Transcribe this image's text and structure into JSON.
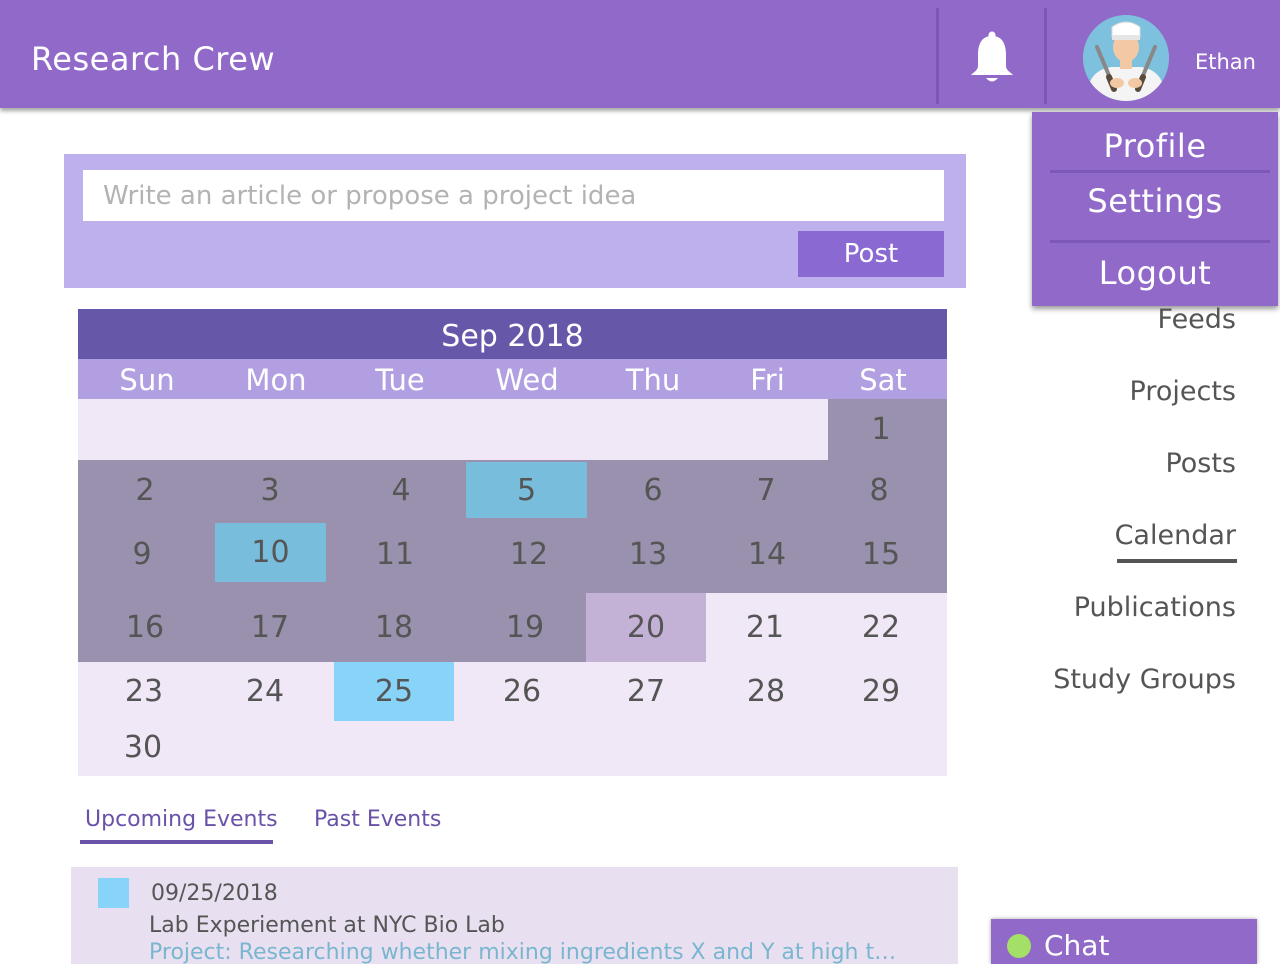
{
  "header": {
    "title": "Research Crew",
    "username": "Ethan",
    "bell_icon": "bell-icon",
    "avatar_icon": "chef-avatar"
  },
  "user_menu": {
    "items": [
      "Profile",
      "Settings",
      "Logout"
    ]
  },
  "composer": {
    "placeholder": "Write an article or propose a project idea",
    "post_label": "Post"
  },
  "calendar": {
    "month_label": "Sep 2018",
    "weekdays": [
      "Sun",
      "Mon",
      "Tue",
      "Wed",
      "Thu",
      "Fri",
      "Sat"
    ],
    "days": [
      "1",
      "2",
      "3",
      "4",
      "5",
      "6",
      "7",
      "8",
      "9",
      "10",
      "11",
      "12",
      "13",
      "14",
      "15",
      "16",
      "17",
      "18",
      "19",
      "20",
      "21",
      "22",
      "23",
      "24",
      "25",
      "26",
      "27",
      "28",
      "29",
      "30"
    ],
    "colors": {
      "past": "#9991ad",
      "event": "#78bddb",
      "today": "#c4b1d6",
      "upcoming_event": "#88d3f8",
      "future": "#f0e8f6"
    }
  },
  "events": {
    "tabs": [
      "Upcoming Events",
      "Past Events"
    ],
    "list": [
      {
        "date": "09/25/2018",
        "title": "Lab Experiement at NYC Bio Lab",
        "description": "Project: Researching whether mixing ingredients X and Y at high temp ..."
      }
    ]
  },
  "nav": {
    "items": [
      "Feeds",
      "Projects",
      "Posts",
      "Calendar",
      "Publications",
      "Study Groups"
    ],
    "active": "Calendar"
  },
  "chat": {
    "label": "Chat",
    "status_color": "#a4df68"
  },
  "theme": {
    "primary": "#9169c8",
    "calendar_header": "#6657a9",
    "accent_button": "#8a6ad2"
  }
}
